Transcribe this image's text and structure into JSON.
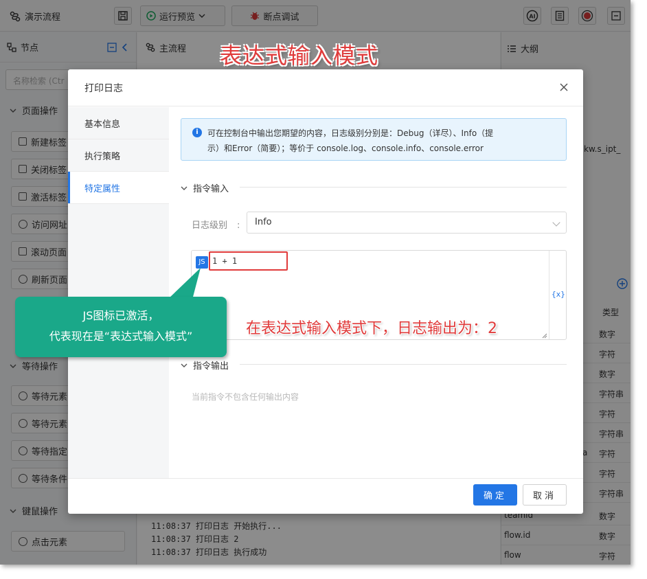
{
  "app": {
    "title": "演示流程",
    "run_preview_label": "运行预览",
    "debug_label": "断点调试"
  },
  "left_panel": {
    "title": "节点",
    "search_placeholder": "名称检索 (Ctr",
    "groups": [
      {
        "label": "页面操作"
      },
      {
        "label": "等待操作"
      },
      {
        "label": "键鼠操作"
      }
    ],
    "items": [
      {
        "label": "新建标签"
      },
      {
        "label": "关闭标签"
      },
      {
        "label": "激活标签"
      },
      {
        "label": "访问网址"
      },
      {
        "label": "滚动页面"
      },
      {
        "label": "刷新页面"
      },
      {
        "label": "等待元素"
      },
      {
        "label": "等待元素"
      },
      {
        "label": "等待指定"
      },
      {
        "label": "等待条件"
      },
      {
        "label": "点击元素"
      }
    ]
  },
  "center": {
    "tab_label": "主流程",
    "logs": [
      "11:08:37 打印日志 开始执行...",
      "11:08:37 打印日志 2",
      "11:08:37 打印日志 执行成功"
    ]
  },
  "right_panel": {
    "title": "大纲",
    "frag_text": "kw.s_ipt_",
    "type_header": "类型",
    "rows": [
      {
        "name": "",
        "type": "数字"
      },
      {
        "name": "",
        "type": "字符"
      },
      {
        "name": "",
        "type": "数字"
      },
      {
        "name": "",
        "type": "字符串"
      },
      {
        "name": "",
        "type": "字符"
      },
      {
        "name": "",
        "type": "字符串"
      },
      {
        "name": "a",
        "type": "字符"
      },
      {
        "name": "",
        "type": "字符"
      },
      {
        "name": "",
        "type": "字符串"
      },
      {
        "name": "teamid",
        "type": "数字"
      },
      {
        "name": "flow.id",
        "type": "数字"
      },
      {
        "name": "flow",
        "type": "字符"
      }
    ]
  },
  "modal": {
    "title": "打印日志",
    "side_tabs": [
      {
        "label": "基本信息"
      },
      {
        "label": "执行策略"
      },
      {
        "label": "特定属性"
      }
    ],
    "info_line1": "可在控制台中输出您期望的内容，日志级别分别是：Debug（详尽）、Info（提",
    "info_line2": "示）和Error（简要）；等价于 console.log、console.info、console.error",
    "section_input": "指令输入",
    "log_level_label": "日志级别",
    "log_level_value": "Info",
    "js_badge": "JS",
    "code": "1 + 1",
    "var_button": "{x}",
    "section_output": "指令输出",
    "empty_output": "当前指令不包含任何输出内容",
    "ok_label": "确定",
    "cancel_label": "取消"
  },
  "annotations": {
    "title": "表达式输入模式",
    "callout_line1": "JS图标已激活，",
    "callout_line2": "代表现在是“表达式输入模式”",
    "note": "在表达式输入模式下，日志输出为：2"
  },
  "colors": {
    "primary": "#2376e5",
    "annotation_red": "#e03b3b",
    "callout_green": "#1aa889",
    "info_bg": "#e8f4fd"
  }
}
